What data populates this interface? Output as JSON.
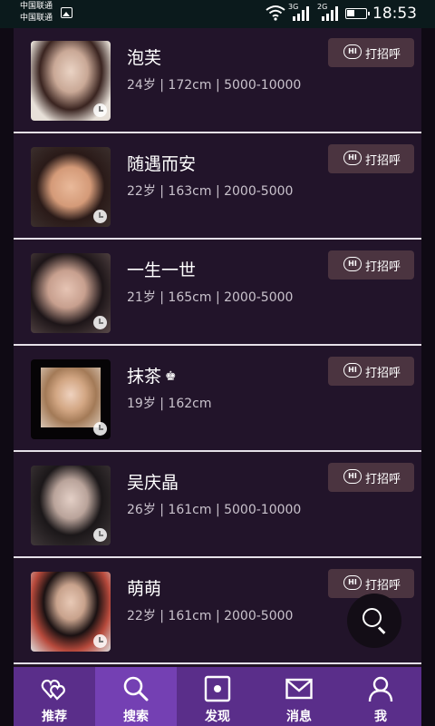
{
  "status_bar": {
    "carrier_1": "中国联通",
    "carrier_2": "中国联通",
    "network_1": "3G",
    "network_2": "2G",
    "time": "18:53"
  },
  "people": [
    {
      "name": "泡芙",
      "info": "24岁 | 172cm | 5000-10000",
      "vip": false
    },
    {
      "name": "随遇而安",
      "info": "22岁 | 163cm | 2000-5000",
      "vip": false
    },
    {
      "name": "一生一世",
      "info": "21岁 | 165cm | 2000-5000",
      "vip": false
    },
    {
      "name": "抹茶",
      "info": "19岁 | 162cm",
      "vip": true
    },
    {
      "name": "吴庆晶",
      "info": "26岁 | 161cm | 5000-10000",
      "vip": false
    },
    {
      "name": "萌萌",
      "info": "22岁 | 161cm | 2000-5000",
      "vip": false
    }
  ],
  "greet_button": {
    "label": "打招呼",
    "icon_text": "HI"
  },
  "crown_glyph": "♚",
  "tabs": [
    {
      "label": "推荐",
      "icon": "hearts-icon",
      "active": false
    },
    {
      "label": "搜索",
      "icon": "search-icon",
      "active": true
    },
    {
      "label": "发现",
      "icon": "discover-icon",
      "active": false
    },
    {
      "label": "消息",
      "icon": "mail-icon",
      "active": false
    },
    {
      "label": "我",
      "icon": "person-icon",
      "active": false
    }
  ],
  "colors": {
    "background": "#231527",
    "tab_bar": "#5a2e8a",
    "tab_active": "#7440b3",
    "greet_button": "#4b3440"
  }
}
